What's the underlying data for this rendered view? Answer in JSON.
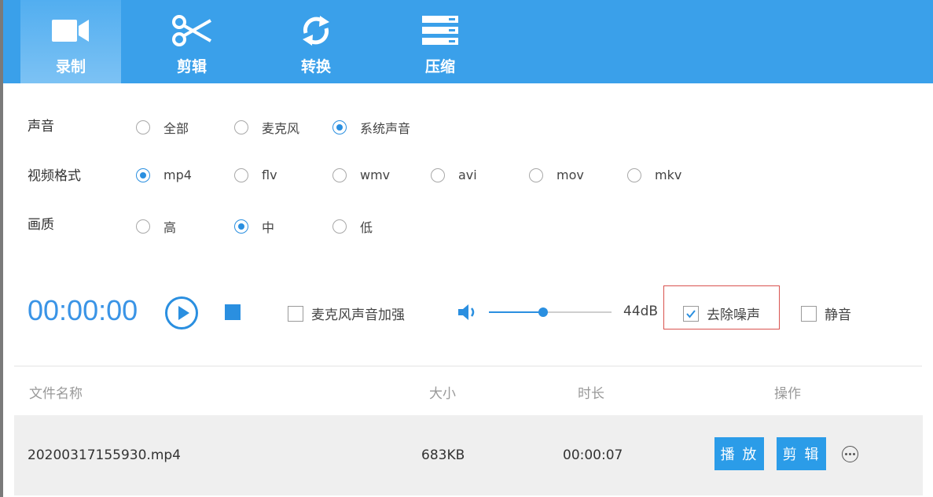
{
  "tabs": [
    {
      "label": "录制",
      "icon": "video-camera-icon",
      "active": true
    },
    {
      "label": "剪辑",
      "icon": "scissors-icon",
      "active": false
    },
    {
      "label": "转换",
      "icon": "convert-refresh-icon",
      "active": false
    },
    {
      "label": "压缩",
      "icon": "compress-stack-icon",
      "active": false
    }
  ],
  "settings": {
    "sound": {
      "label": "声音",
      "options": [
        "全部",
        "麦克风",
        "系统声音"
      ],
      "selected": "系统声音"
    },
    "format": {
      "label": "视频格式",
      "options": [
        "mp4",
        "flv",
        "wmv",
        "avi",
        "mov",
        "mkv"
      ],
      "selected": "mp4"
    },
    "quality": {
      "label": "画质",
      "options": [
        "高",
        "中",
        "低"
      ],
      "selected": "中"
    }
  },
  "controls": {
    "timer": "00:00:00",
    "mic_boost_label": "麦克风声音加强",
    "mic_boost_checked": false,
    "volume_percent": 44,
    "volume_text": "44dB",
    "denoise_label": "去除噪声",
    "denoise_checked": true,
    "mute_label": "静音",
    "mute_checked": false
  },
  "table": {
    "headers": {
      "name": "文件名称",
      "size": "大小",
      "duration": "时长",
      "actions": "操作"
    },
    "rows": [
      {
        "name": "20200317155930.mp4",
        "size": "683KB",
        "duration": "00:00:07",
        "play_label": "播 放",
        "edit_label": "剪 辑"
      }
    ]
  },
  "colors": {
    "accent": "#3aa0ea",
    "button": "#2b9ce8",
    "highlight_border": "#d9534f"
  }
}
